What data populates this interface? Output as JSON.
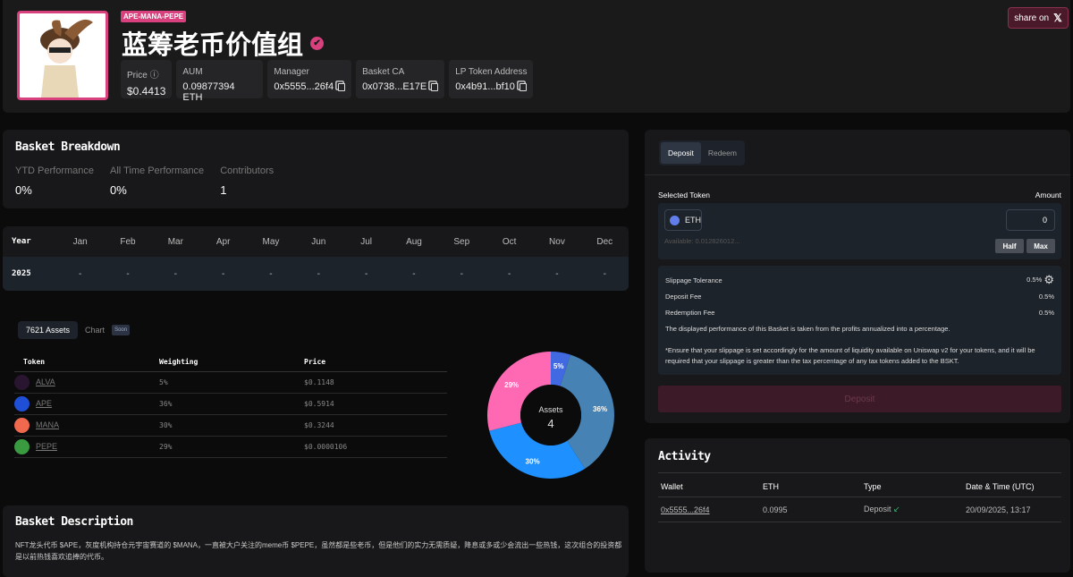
{
  "header": {
    "tag": "APE-MANA-PEPE",
    "title": "蓝筹老币价值组",
    "share_label": "share on",
    "share_icon": "x-logo-icon",
    "stats": [
      {
        "label": "Price",
        "value": "$0.4413",
        "info": true
      },
      {
        "label": "AUM",
        "value": "0.09877394 ETH"
      },
      {
        "label": "Manager",
        "value": "0x5555...26f4",
        "copy": true
      },
      {
        "label": "Basket CA",
        "value": "0x0738...E17E",
        "copy": true
      },
      {
        "label": "LP Token Address",
        "value": "0x4b91...bf10",
        "copy": true
      }
    ]
  },
  "breakdown": {
    "title": "Basket Breakdown",
    "items": [
      {
        "label": "YTD Performance",
        "value": "0%"
      },
      {
        "label": "All Time Performance",
        "value": "0%"
      },
      {
        "label": "Contributors",
        "value": "1"
      }
    ]
  },
  "monthly": {
    "header": [
      "Year",
      "Jan",
      "Feb",
      "Mar",
      "Apr",
      "May",
      "Jun",
      "Jul",
      "Aug",
      "Sep",
      "Oct",
      "Nov",
      "Dec"
    ],
    "row": [
      "2025",
      "-",
      "-",
      "-",
      "-",
      "-",
      "-",
      "-",
      "-",
      "-",
      "-",
      "-",
      "-"
    ]
  },
  "assets": {
    "tab_assets": "7621 Assets",
    "tab_chart": "Chart",
    "soon": "Soon",
    "columns": [
      "Token",
      "Weighting",
      "Price"
    ],
    "rows": [
      {
        "token": "ALVA",
        "weight": "5%",
        "price": "$0.1148",
        "color": "#2a1530"
      },
      {
        "token": "APE",
        "weight": "36%",
        "price": "$0.5914",
        "color": "#1f4fd6"
      },
      {
        "token": "MANA",
        "weight": "30%",
        "price": "$0.3244",
        "color": "#f0684e"
      },
      {
        "token": "PEPE",
        "weight": "29%",
        "price": "$0.0000106",
        "color": "#3a9a40"
      }
    ]
  },
  "chart_data": {
    "type": "pie",
    "center_label": "Assets",
    "center_value": "4",
    "categories": [
      "ALVA",
      "APE",
      "MANA",
      "PEPE"
    ],
    "values": [
      5,
      36,
      30,
      29
    ],
    "labels": [
      "5%",
      "36%",
      "30%",
      "29%"
    ],
    "colors": [
      "#4169e1",
      "#4682b4",
      "#1e90ff",
      "#ff69b4"
    ]
  },
  "description": {
    "title": "Basket Description",
    "text": "NFT龙头代币 $APE，灰度机构持仓元宇宙赛道的 $MANA，一直被大户关注的meme币 $PEPE，虽然都是些老币，但是他们的实力无需质疑，降息或多或少会流出一些热钱，这次组合的投资都是以前热钱喜欢追捧的代币。"
  },
  "deposit": {
    "tab_deposit": "Deposit",
    "tab_redeem": "Redeem",
    "selected_token_label": "Selected Token",
    "amount_label": "Amount",
    "token": "ETH",
    "amount": "0",
    "available": "Available: 0.012826012...",
    "half": "Half",
    "max": "Max",
    "slippage_label": "Slippage Tolerance",
    "slippage": "0.5%",
    "deposit_fee_label": "Deposit Fee",
    "deposit_fee": "0.5%",
    "redemption_fee_label": "Redemption Fee",
    "redemption_fee": "0.5%",
    "note1": "The displayed performance of this Basket is taken from the profits annualized into a percentage.",
    "note2": "*Ensure that your slippage is set accordingly for the amount of liquidity available on Uniswap v2 for your tokens, and it will be required that your slippage is greater than the tax percentage of any tax tokens added to the BSKT.",
    "button": "Deposit"
  },
  "activity": {
    "title": "Activity",
    "columns": [
      "Wallet",
      "ETH",
      "Type",
      "Date & Time (UTC)"
    ],
    "rows": [
      {
        "wallet": "0x5555...26f4",
        "eth": "0.0995",
        "type": "Deposit",
        "time": "20/09/2025, 13:17"
      }
    ]
  }
}
